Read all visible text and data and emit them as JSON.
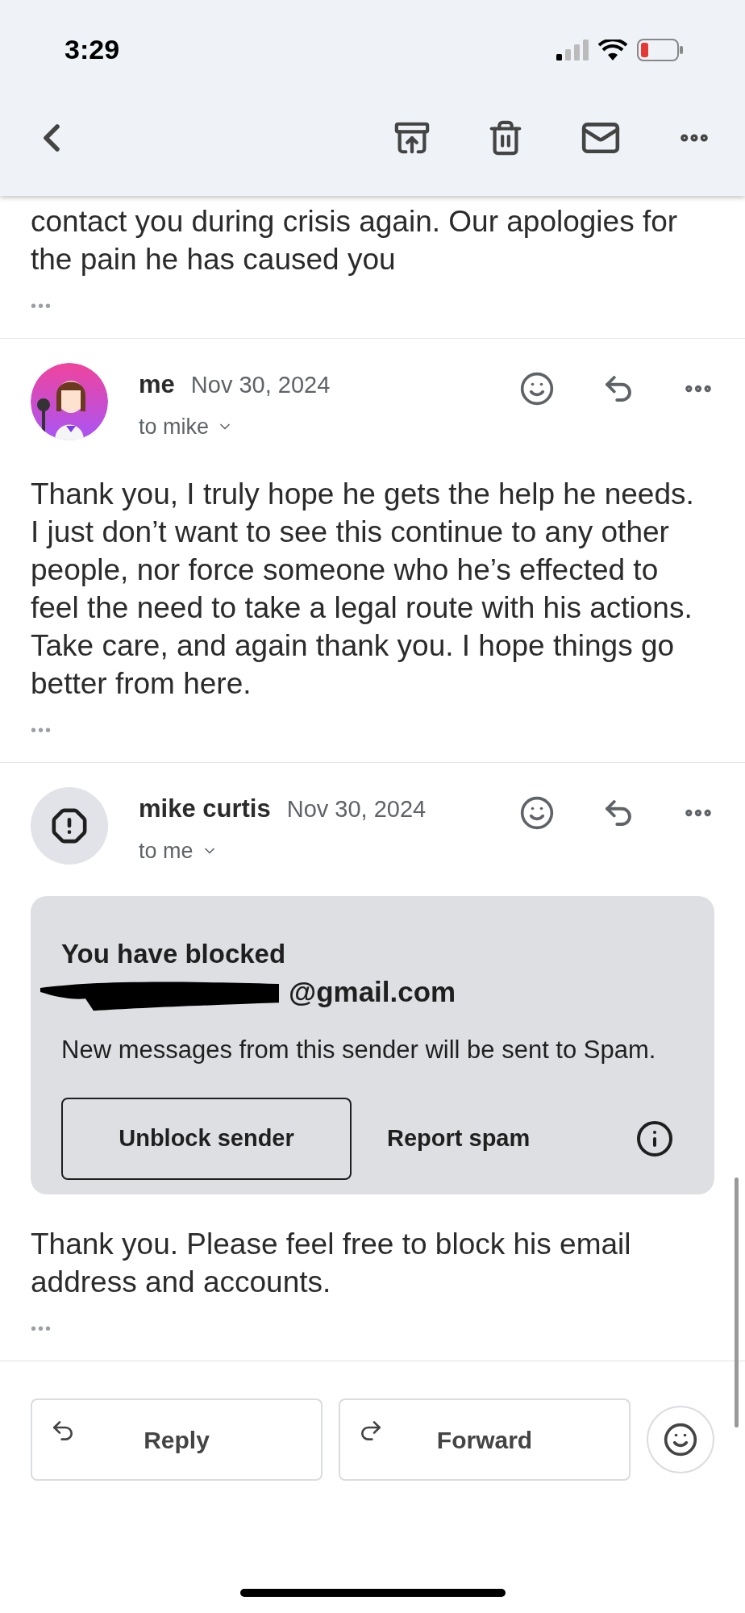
{
  "status_bar": {
    "time": "3:29"
  },
  "messages": [
    {
      "kind": "partial",
      "body": "contact you during crisis again. Our apologies for the pain he has caused you",
      "more": "•••"
    },
    {
      "kind": "full",
      "sender": "me",
      "date": "Nov 30, 2024",
      "recipient": "to mike",
      "body": "Thank you, I truly hope he gets the help he needs. I just don’t want to see this continue to any other people, nor force someone who he’s effected to feel the need to take a legal route with his actions. Take care, and again thank you. I hope things go better from here.",
      "more": "•••"
    },
    {
      "kind": "full",
      "sender": "mike curtis",
      "date": "Nov 30, 2024",
      "recipient": "to me",
      "avatar": {
        "kind": "warning"
      },
      "blocked_notice": {
        "title": "You have blocked",
        "email": "@gmail.com",
        "redacted": true,
        "text": "New messages from this sender will be sent to Spam.",
        "unblock_button": "Unblock sender",
        "report_button": "Report spam"
      },
      "body": "Thank you. Please feel free to block his email address and accounts.",
      "more": "•••"
    }
  ],
  "actions": {
    "reply": "Reply",
    "forward": "Forward"
  }
}
